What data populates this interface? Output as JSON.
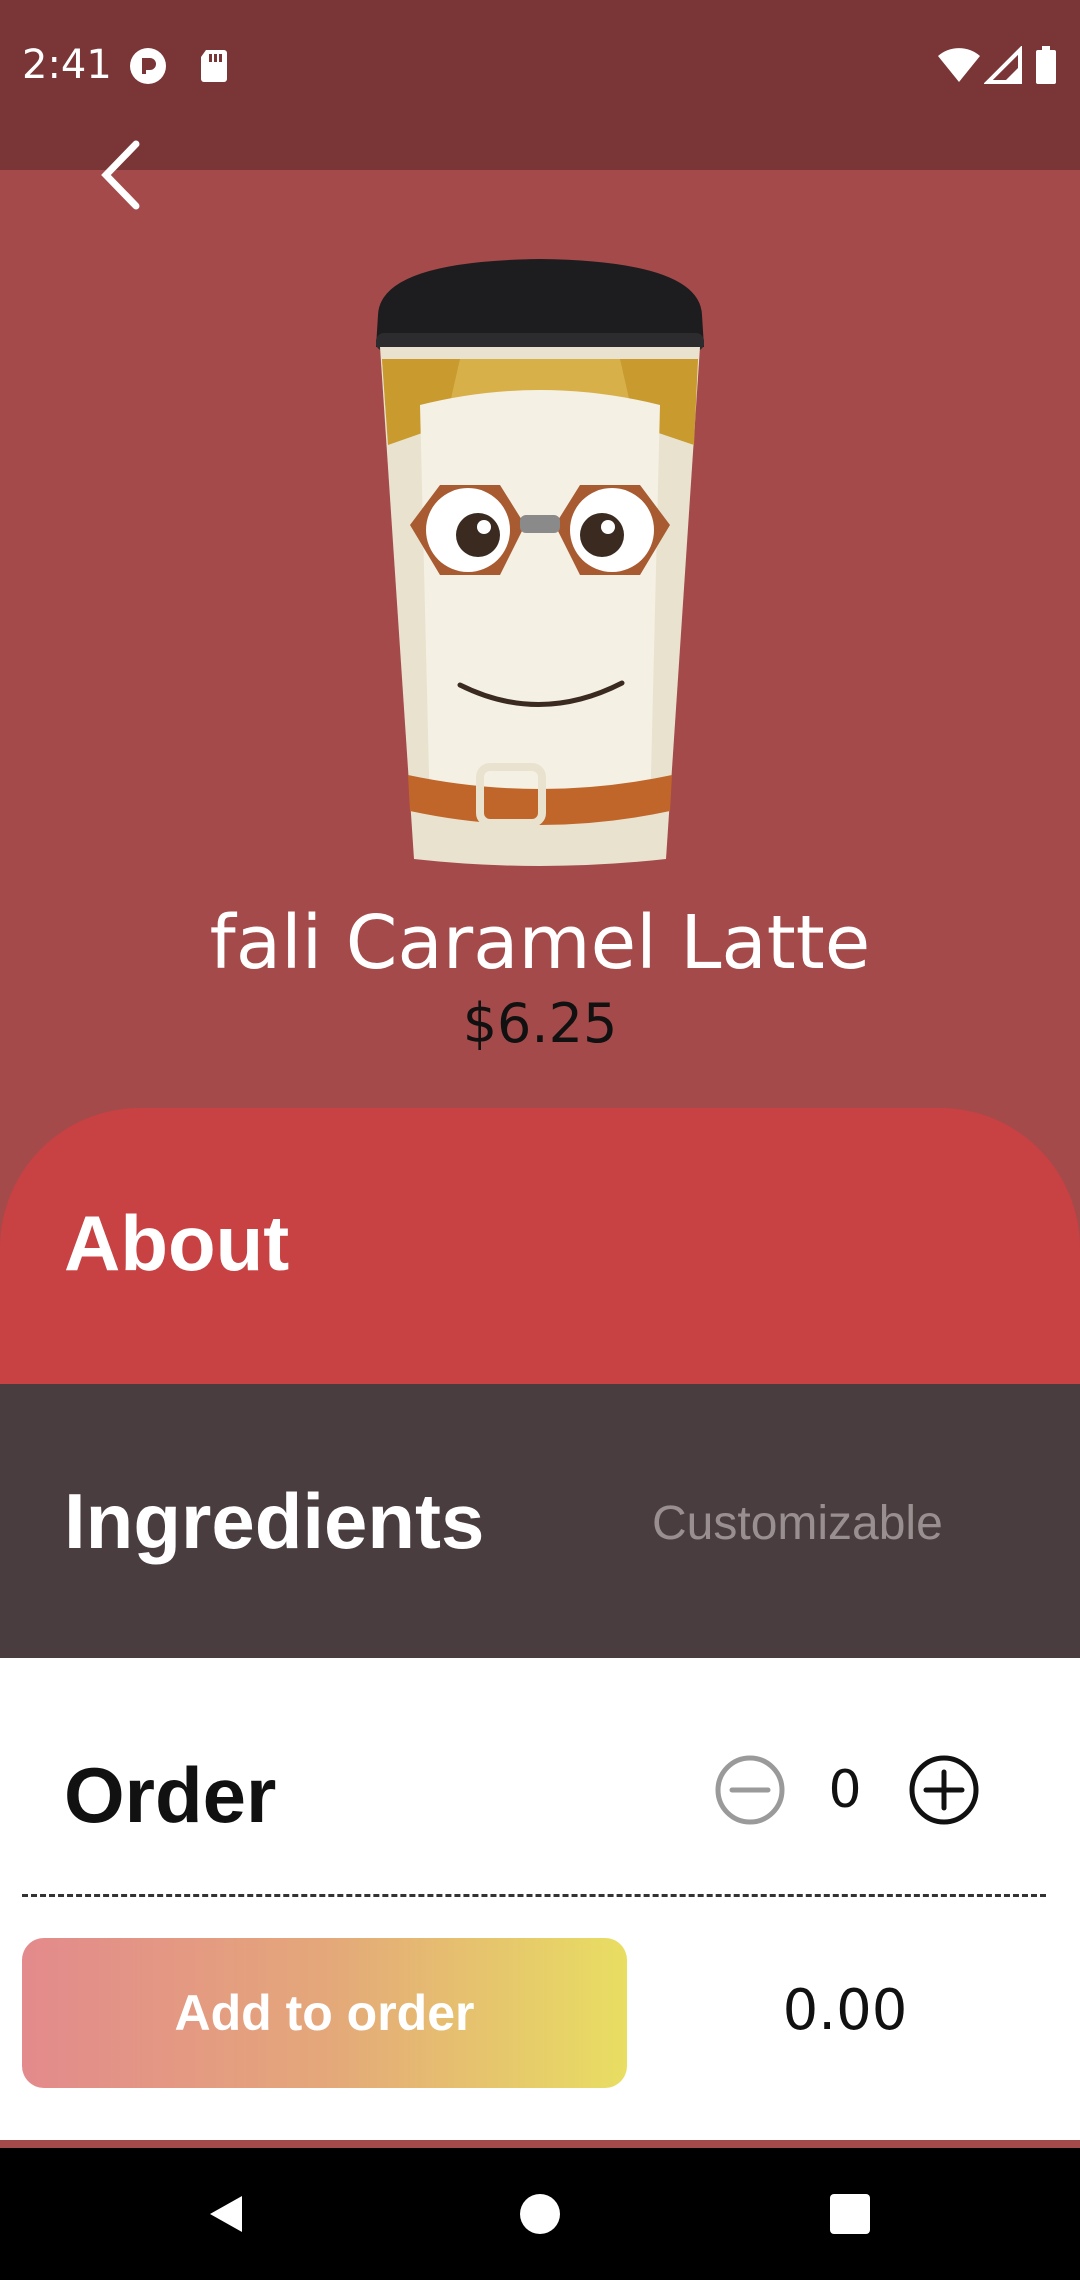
{
  "status_bar": {
    "time": "2:41",
    "icons": [
      "pocket-casts-icon",
      "sd-card-icon",
      "wifi-icon",
      "signal-icon",
      "battery-icon"
    ]
  },
  "header": {
    "back_icon": "chevron-left-icon"
  },
  "product": {
    "name": "fali Caramel Latte",
    "price": "$6.25",
    "image": "coffee-cup-with-goggles-illustration"
  },
  "sections": {
    "about": "About",
    "ingredients": "Ingredients",
    "ingredients_note": "Customizable",
    "order": "Order"
  },
  "order": {
    "quantity": "0",
    "add_button": "Add to order",
    "total": "0.00"
  },
  "nav_bar": {
    "icons": [
      "back-triangle-icon",
      "home-circle-icon",
      "recents-square-icon"
    ]
  },
  "colors": {
    "status_bar": "#7a3537",
    "hero_bg": "#a54a4a",
    "about_bg": "#c84143",
    "ingredients_bg": "#4a3d3f",
    "gradient_start": "#e38a8c",
    "gradient_end": "#e8de62"
  }
}
